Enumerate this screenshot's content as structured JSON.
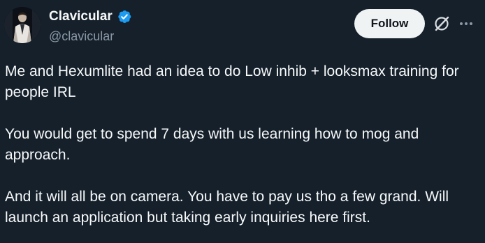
{
  "author": {
    "display_name": "Clavicular",
    "handle": "@clavicular",
    "verified": true,
    "verified_color": "#1d9bf0"
  },
  "actions": {
    "follow_label": "Follow",
    "grok_icon": "grok-slash-circle-icon",
    "more_icon": "more-horizontal-icon"
  },
  "tweet": {
    "paragraphs": [
      "Me and Hexumlite had an idea to do Low inhib + looksmax training for people IRL",
      "You would get to spend 7 days with us learning how to mog and approach.",
      "And it will all be on camera. You have to pay us tho a few grand. Will launch an application but taking early inquiries here first."
    ]
  },
  "theme": {
    "background": "#15202b",
    "text_primary": "#f7f9f9",
    "text_secondary": "#8b98a5",
    "button_bg": "#eff3f4",
    "button_text": "#0f1419"
  }
}
